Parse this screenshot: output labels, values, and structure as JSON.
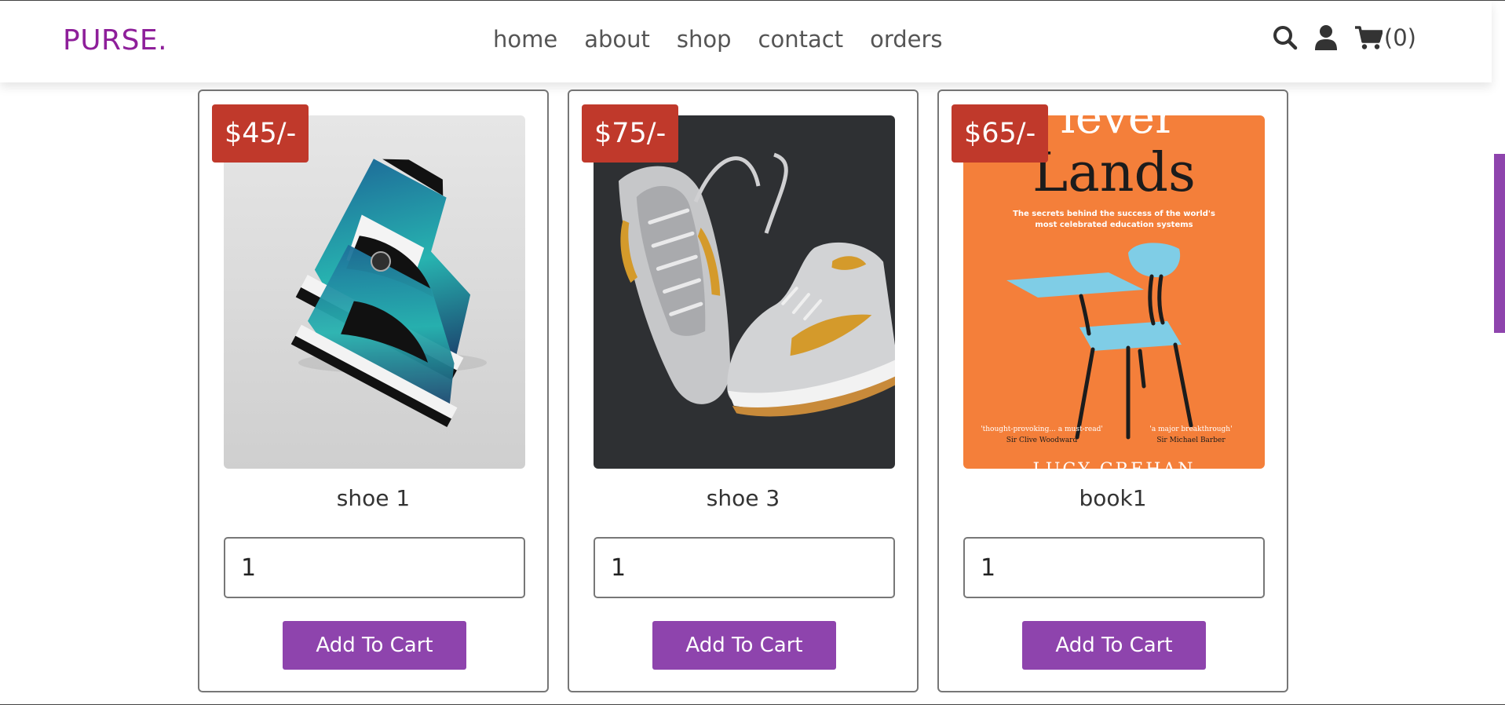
{
  "header": {
    "logo": "PURSE.",
    "nav": [
      "home",
      "about",
      "shop",
      "contact",
      "orders"
    ],
    "cart_count": "(0)"
  },
  "icons": [
    "search-icon",
    "user-icon",
    "cart-icon"
  ],
  "colors": {
    "logo": "#8e1f9a",
    "price_badge": "#c0392b",
    "button": "#8e44ad",
    "side_tab": "#8e44ad"
  },
  "products": [
    {
      "price": "$45/-",
      "name": "shoe 1",
      "qty": "1",
      "button": "Add To Cart"
    },
    {
      "price": "$75/-",
      "name": "shoe 3",
      "qty": "1",
      "button": "Add To Cart"
    },
    {
      "price": "$65/-",
      "name": "book1",
      "qty": "1",
      "button": "Add To Cart",
      "image_text": {
        "title_top": "lever",
        "title": "Lands",
        "subtitle_line1": "The secrets behind the success of the world's",
        "subtitle_line2": "most celebrated education systems",
        "quote1": "'thought-provoking... a must-read'",
        "quote1_author": "Sir Clive Woodward",
        "quote2": "'a major breakthrough'",
        "quote2_author": "Sir Michael Barber",
        "author_partial": "LUCY CREHAN"
      }
    }
  ]
}
